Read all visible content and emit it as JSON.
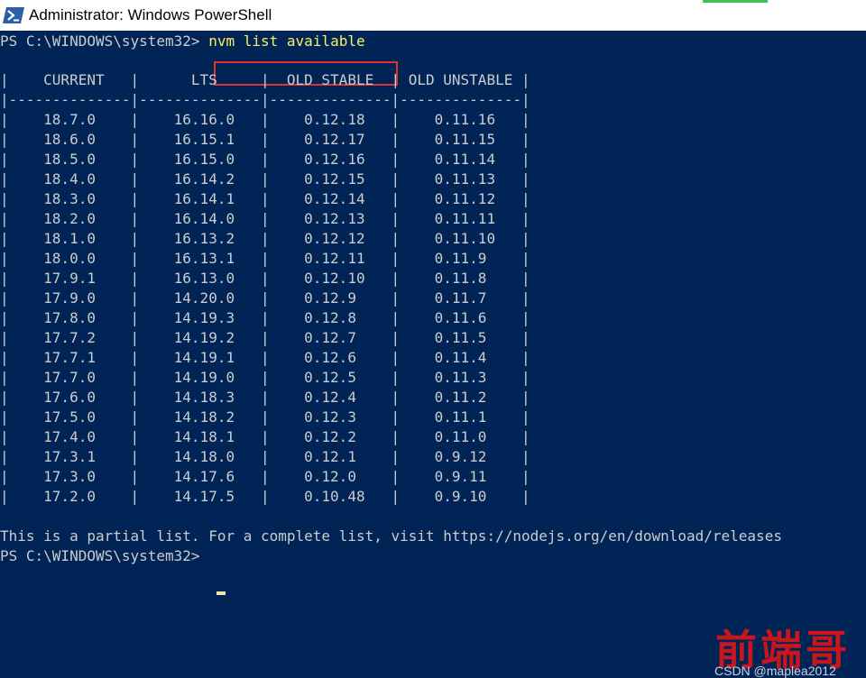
{
  "window": {
    "title": "Administrator: Windows PowerShell",
    "icon": "powershell-icon",
    "accent_color": "#3fbf58"
  },
  "console": {
    "prompt": "PS C:\\WINDOWS\\system32>",
    "command": "nvm list available",
    "highlight_color": "#e0322f",
    "text_color": "#cccccc",
    "command_color": "#f5f067",
    "background": "#012456",
    "table": {
      "columns": [
        "CURRENT",
        "LTS",
        "OLD STABLE",
        "OLD UNSTABLE"
      ],
      "rows": [
        [
          "18.7.0",
          "16.16.0",
          "0.12.18",
          "0.11.16"
        ],
        [
          "18.6.0",
          "16.15.1",
          "0.12.17",
          "0.11.15"
        ],
        [
          "18.5.0",
          "16.15.0",
          "0.12.16",
          "0.11.14"
        ],
        [
          "18.4.0",
          "16.14.2",
          "0.12.15",
          "0.11.13"
        ],
        [
          "18.3.0",
          "16.14.1",
          "0.12.14",
          "0.11.12"
        ],
        [
          "18.2.0",
          "16.14.0",
          "0.12.13",
          "0.11.11"
        ],
        [
          "18.1.0",
          "16.13.2",
          "0.12.12",
          "0.11.10"
        ],
        [
          "18.0.0",
          "16.13.1",
          "0.12.11",
          "0.11.9"
        ],
        [
          "17.9.1",
          "16.13.0",
          "0.12.10",
          "0.11.8"
        ],
        [
          "17.9.0",
          "14.20.0",
          "0.12.9",
          "0.11.7"
        ],
        [
          "17.8.0",
          "14.19.3",
          "0.12.8",
          "0.11.6"
        ],
        [
          "17.7.2",
          "14.19.2",
          "0.12.7",
          "0.11.5"
        ],
        [
          "17.7.1",
          "14.19.1",
          "0.12.6",
          "0.11.4"
        ],
        [
          "17.7.0",
          "14.19.0",
          "0.12.5",
          "0.11.3"
        ],
        [
          "17.6.0",
          "14.18.3",
          "0.12.4",
          "0.11.2"
        ],
        [
          "17.5.0",
          "14.18.2",
          "0.12.3",
          "0.11.1"
        ],
        [
          "17.4.0",
          "14.18.1",
          "0.12.2",
          "0.11.0"
        ],
        [
          "17.3.1",
          "14.18.0",
          "0.12.1",
          "0.9.12"
        ],
        [
          "17.3.0",
          "14.17.6",
          "0.12.0",
          "0.9.11"
        ],
        [
          "17.2.0",
          "14.17.5",
          "0.10.48",
          "0.9.10"
        ]
      ]
    },
    "footer_note": "This is a partial list. For a complete list, visit https://nodejs.org/en/download/releases",
    "cursor_color": "#f0e6a8"
  },
  "watermark": {
    "logo_text": "前端哥",
    "logo_color": "#c8161d",
    "credit": "CSDN @maplea2012"
  }
}
